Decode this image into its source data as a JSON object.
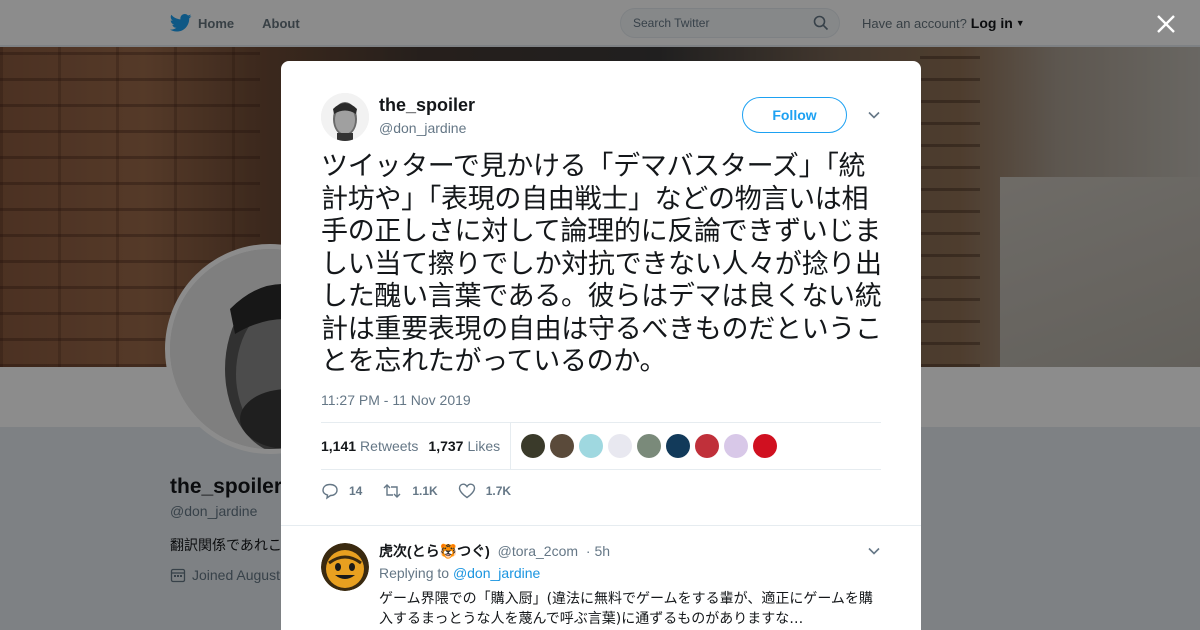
{
  "nav": {
    "home_label": "Home",
    "about_label": "About",
    "search_placeholder": "Search Twitter",
    "have_account": "Have an account?",
    "login_label": "Log in"
  },
  "profile": {
    "name": "the_spoiler",
    "handle": "@don_jardine",
    "bio": "翻訳関係であれこ",
    "joined": "Joined August"
  },
  "tweet": {
    "name": "the_spoiler",
    "handle": "@don_jardine",
    "follow_label": "Follow",
    "text": "ツイッターで見かける「デマバスターズ」「統計坊や」「表現の自由戦士」などの物言いは相手の正しさに対して論理的に反論できずいじましい当て擦りでしか対抗できない人々が捻り出した醜い言葉である。彼らはデマは良くない統計は重要表現の自由は守るべきものだということを忘れたがっているのか。",
    "timestamp": "11:27 PM - 11 Nov 2019",
    "retweets_count": "1,141",
    "retweets_label": "Retweets",
    "likes_count": "1,737",
    "likes_label": "Likes",
    "reply_count": "14",
    "retweet_action_count": "1.1K",
    "like_action_count": "1.7K",
    "liker_colors": [
      "#3a3a2a",
      "#5a4a3a",
      "#9fd8e0",
      "#e8e8f0",
      "#7a8a7a",
      "#123a5a",
      "#c0303a",
      "#d8c8e8",
      "#d01020"
    ]
  },
  "reply": {
    "name": "虎次(とら🐯つぐ)",
    "handle": "@tora_2com",
    "age": "· 5h",
    "replying_prefix": "Replying to",
    "replying_to": "@don_jardine",
    "text": "ゲーム界隈での「購入厨」(違法に無料でゲームをする輩が、適正にゲームを購入するまっとうな人を蔑んで呼ぶ言葉)に通ずるものがありますな…"
  },
  "colors": {
    "accent": "#1da1f2",
    "text_primary": "#14171a",
    "text_secondary": "#657786"
  }
}
